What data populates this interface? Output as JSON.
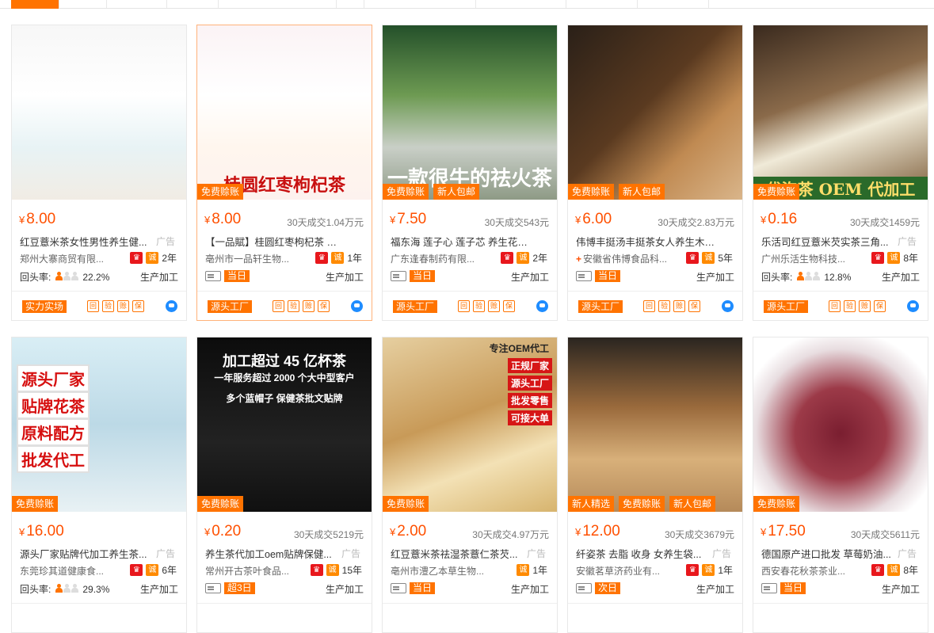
{
  "currency": "¥",
  "rate_label": "回头率:",
  "cards": [
    {
      "price": "8.00",
      "sold": "",
      "title": "红豆薏米茶女性男性养生健...",
      "ad": "广告",
      "company": "郑州大寨商贸有限...",
      "years": "2年",
      "rate": "22.2%",
      "ship": "",
      "process": "生产加工",
      "tags": [],
      "banner": "",
      "footer_tag": "实力实场",
      "bg": "linear-gradient(180deg,#f7f7f7,#ffffff 40%,#e8f3f5 70%,#f1ece4)"
    },
    {
      "price": "8.00",
      "sold": "30天成交1.04万元",
      "title": "【一品賦】桂圆红枣枸杞茶 一盒18...",
      "ad": "",
      "company": "亳州市一品轩生物...",
      "years": "1年",
      "rate": "",
      "ship": "当日",
      "process": "生产加工",
      "tags": [
        "免费赊账"
      ],
      "banner": "桂圆红枣枸杞茶",
      "footer_tag": "源头工厂",
      "bg": "linear-gradient(180deg,#fbf3f5,#fff 40%,#fff6ee 70%,#fdf2ee)"
    },
    {
      "price": "7.50",
      "sold": "30天成交543元",
      "title": "福东海 莲子心 莲子芯 养生花茶150...",
      "ad": "",
      "company": "广东逢春制药有限...",
      "years": "2年",
      "rate": "",
      "ship": "当日",
      "process": "生产加工",
      "tags": [
        "免费赊账",
        "新人包邮"
      ],
      "banner": "一款很牛的祛火茶",
      "footer_tag": "源头工厂",
      "bg": "linear-gradient(180deg,#24502a,#6d9a52 40%,#c9cfc7 70%,#8e9a86)"
    },
    {
      "price": "6.00",
      "sold": "30天成交2.83万元",
      "title": "伟博丰挺汤丰挺茶女人养生木瓜葛...",
      "ad": "",
      "company": "安徽省伟博食品科...",
      "years": "5年",
      "rate": "",
      "ship": "当日",
      "process": "生产加工",
      "tags": [
        "免费赊账",
        "新人包邮"
      ],
      "banner": "",
      "footer_tag": "源头工厂",
      "bg": "linear-gradient(135deg,#2a2018,#5a3a20 45%,#c08a52 70%,#d9b58a)",
      "comp_plus": true
    },
    {
      "price": "0.16",
      "sold": "30天成交1459元",
      "title": "乐活司红豆薏米芡实茶三角...",
      "ad": "广告",
      "company": "广州乐活生物科技...",
      "years": "8年",
      "rate": "12.8%",
      "ship": "",
      "process": "生产加工",
      "tags": [
        "免费赊账"
      ],
      "banner": "代泡茶 OEM 代加工",
      "footer_tag": "源头工厂",
      "bg": "linear-gradient(160deg,#3a2a1e,#8a6a4a 40%,#f0ead8 60%,#7a5a36)"
    },
    {
      "price": "16.00",
      "sold": "",
      "title": "源头厂家贴牌代加工养生茶...",
      "ad": "广告",
      "company": "东莞珍其道健康食...",
      "years": "6年",
      "rate": "29.3%",
      "ship": "",
      "process": "生产加工",
      "tags": [
        "免费赊账"
      ],
      "banner": "",
      "footer_tag": "",
      "bg": "linear-gradient(180deg,#d9eef5,#bcd9e6 50%,#e8f1f4)",
      "overlay": [
        "源头厂家",
        "贴牌花茶",
        "原料配方",
        "批发代工"
      ]
    },
    {
      "price": "0.20",
      "sold": "30天成交5219元",
      "title": "养生茶代加工oem贴牌保健...",
      "ad": "广告",
      "company": "常州开古茶叶食品...",
      "years": "15年",
      "rate": "",
      "ship": "超3日",
      "process": "生产加工",
      "tags": [
        "免费赊账"
      ],
      "banner": "",
      "footer_tag": "",
      "bg": "linear-gradient(180deg,#0c0c0c,#222 60%,#101010)",
      "header": [
        "加工超过 45 亿杯茶",
        "一年服务超过 2000 个大中型客户",
        "多个蓝帽子 保健茶批文贴牌"
      ]
    },
    {
      "price": "2.00",
      "sold": "30天成交4.97万元",
      "title": "红豆薏米茶祛湿茶薏仁茶芡...",
      "ad": "广告",
      "company": "亳州市澧乙本草生物...",
      "years": "1年",
      "rate": "",
      "ship": "当日",
      "process": "生产加工",
      "tags": [
        "免费赊账"
      ],
      "banner": "",
      "footer_tag": "",
      "bg": "linear-gradient(160deg,#e6cfa0,#c89a58 45%,#f3e1b5 70%,#d7b46e)",
      "right_labels": [
        "专注OEM代工",
        "正规厂家",
        "源头工厂",
        "批发零售",
        "可接大单"
      ]
    },
    {
      "price": "12.00",
      "sold": "30天成交3679元",
      "title": "纤姿茶 去脂 收身 女养生袋...",
      "ad": "广告",
      "company": "安徽茗草济药业有...",
      "years": "1年",
      "rate": "",
      "ship": "次日",
      "process": "生产加工",
      "tags": [
        "新人精选",
        "免费赊账",
        "新人包邮"
      ],
      "banner": "",
      "footer_tag": "",
      "bg": "linear-gradient(180deg,#2a2520,#9a6a3c 40%,#d8b07a 70%,#b58a5a)"
    },
    {
      "price": "17.50",
      "sold": "30天成交5611元",
      "title": "德国原产进口批发 草莓奶油...",
      "ad": "广告",
      "company": "西安春花秋茶茶业...",
      "years": "8年",
      "rate": "",
      "ship": "当日",
      "process": "生产加工",
      "tags": [
        "免费赊账"
      ],
      "banner": "",
      "footer_tag": "",
      "bg": "radial-gradient(circle at 50% 55%,#7a1e30,#9c3a48 35%,#e8dde0 65%,#ffffff 80%)"
    }
  ],
  "footer_icons": [
    "回",
    "验",
    "赊",
    "保"
  ]
}
